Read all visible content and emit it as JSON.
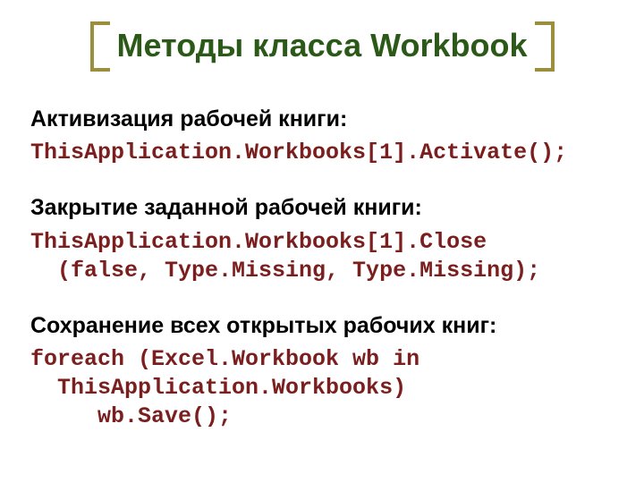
{
  "title": "Методы класса Workbook",
  "sections": {
    "activation": {
      "label": "Активизация рабочей книги:",
      "code": "ThisApplication.Workbooks[1].Activate();"
    },
    "close": {
      "label": "Закрытие заданной рабочей книги:",
      "code": "ThisApplication.Workbooks[1].Close\n  (false, Type.Missing, Type.Missing);"
    },
    "save": {
      "label": "Сохранение всех открытых рабочих книг:",
      "code": "foreach (Excel.Workbook wb in\n  ThisApplication.Workbooks)\n     wb.Save();"
    }
  }
}
